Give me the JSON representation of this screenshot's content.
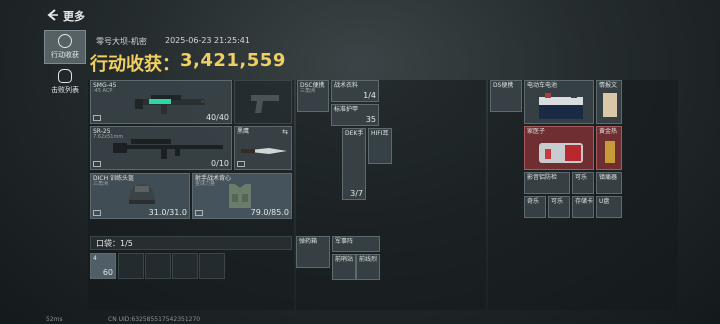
{
  "top_bar": {
    "title": "更多",
    "back_icon": "back-arrow-icon"
  },
  "side_tabs": [
    {
      "label": "行动收获",
      "icon": "target-icon",
      "active": true
    },
    {
      "label": "击败列表",
      "icon": "skull-icon",
      "active": false
    }
  ],
  "header": {
    "map_name": "零号大坝-机密",
    "timestamp": "2025-06-23 21:25:41",
    "harvest_label": "行动收获：",
    "harvest_value": "3,421,559"
  },
  "gear": {
    "weapon1": {
      "name": "SMG-45",
      "ammo": ".45 ACP",
      "count": "40/40"
    },
    "weapon2": {
      "name": "SR-25",
      "ammo": "7.62x51mm",
      "count": "0/10"
    },
    "knife": {
      "name": "黑鹰"
    },
    "helmet": {
      "name": "DICH 训练头盔",
      "sub": "三角洲",
      "durability": "31.0/31.0"
    },
    "vest": {
      "name": "射手战术背心",
      "sub": "金球力量",
      "durability": "79.0/85.0"
    },
    "pocket": {
      "label": "口袋：1/5",
      "item_count": "60",
      "item_label": "4"
    }
  },
  "backpack": {
    "items": [
      {
        "name": "DSC便携",
        "sub": "三角洲"
      },
      {
        "name": "战术衣料",
        "count": "1/4"
      },
      {
        "name": "标准护甲",
        "count": "35"
      },
      {
        "name": "DEK手",
        "count": "3/7"
      },
      {
        "name": "HIFI耳"
      },
      {
        "name": "弹药箱"
      },
      {
        "name": "军事阵",
        "sub": "前哨站"
      },
      {
        "name": "前线烈"
      }
    ]
  },
  "safebox": {
    "items": [
      {
        "name": "DS便携"
      },
      {
        "name": "电动车电池"
      },
      {
        "name": "情报文"
      },
      {
        "name": "家医子"
      },
      {
        "name": "黄金热"
      },
      {
        "name": "影音铝防检"
      },
      {
        "name": "可乐"
      },
      {
        "name": "镇痛器"
      },
      {
        "name": "奇乐"
      },
      {
        "name": "可乐"
      },
      {
        "name": "存储卡"
      },
      {
        "name": "U盘"
      }
    ]
  },
  "status_bar": {
    "ping": "52ms",
    "uid": "CN UID:632585517542351270"
  }
}
